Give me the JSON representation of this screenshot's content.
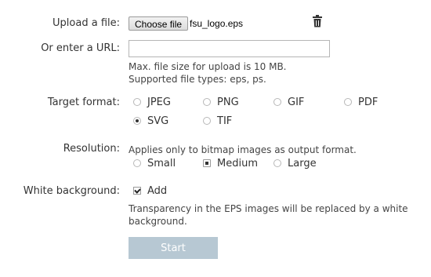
{
  "upload": {
    "label": "Upload a file:",
    "choose_button": "Choose file",
    "file_name": "fsu_logo.eps"
  },
  "url": {
    "label": "Or enter a URL:",
    "value": "",
    "placeholder": "",
    "note_size": "Max. file size for upload is 10 MB.",
    "note_types": "Supported file types: eps, ps."
  },
  "target_format": {
    "label": "Target format:",
    "options": [
      {
        "label": "JPEG",
        "selected": false
      },
      {
        "label": "PNG",
        "selected": false
      },
      {
        "label": "GIF",
        "selected": false
      },
      {
        "label": "PDF",
        "selected": false
      },
      {
        "label": "SVG",
        "selected": true
      },
      {
        "label": "TIF",
        "selected": false
      }
    ]
  },
  "resolution": {
    "label": "Resolution:",
    "note": "Applies only to bitmap images as output format.",
    "options": [
      {
        "label": "Small",
        "selected": false
      },
      {
        "label": "Medium",
        "selected": true
      },
      {
        "label": "Large",
        "selected": false
      }
    ]
  },
  "white_background": {
    "label": "White background:",
    "checkbox_label": "Add",
    "checked": true,
    "note_line1": "Transparency in the EPS images will be replaced by a white",
    "note_line2": "background."
  },
  "start_button": "Start",
  "colors": {
    "start_button_bg": "#b7c8d3",
    "text": "#333333"
  }
}
